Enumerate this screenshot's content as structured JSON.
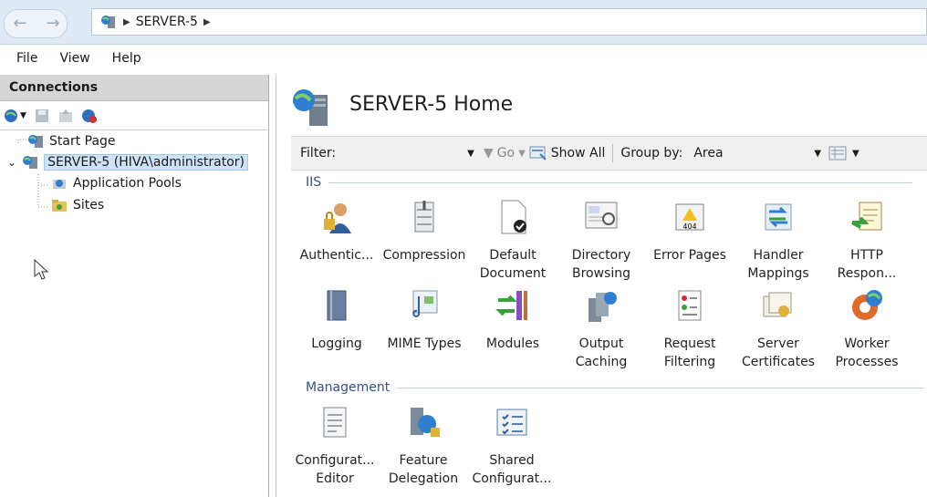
{
  "breadcrumb": {
    "server": "SERVER-5"
  },
  "menu": [
    "File",
    "View",
    "Help"
  ],
  "connections": {
    "header": "Connections",
    "tree": {
      "start_page": "Start Page",
      "server": "SERVER-5 (HIVA\\administrator)",
      "app_pools": "Application Pools",
      "sites": "Sites"
    }
  },
  "main": {
    "title": "SERVER-5 Home",
    "filter": {
      "label": "Filter:",
      "go": "Go",
      "show_all": "Show All",
      "group_by_label": "Group by:",
      "group_by_value": "Area"
    },
    "groups": {
      "iis": "IIS",
      "management": "Management"
    },
    "iis_features": [
      {
        "line1": "Authentic...",
        "line2": ""
      },
      {
        "line1": "Compression",
        "line2": ""
      },
      {
        "line1": "Default",
        "line2": "Document"
      },
      {
        "line1": "Directory",
        "line2": "Browsing"
      },
      {
        "line1": "Error Pages",
        "line2": ""
      },
      {
        "line1": "Handler",
        "line2": "Mappings"
      },
      {
        "line1": "HTTP",
        "line2": "Respon..."
      },
      {
        "line1": "Logging",
        "line2": ""
      },
      {
        "line1": "MIME Types",
        "line2": ""
      },
      {
        "line1": "Modules",
        "line2": ""
      },
      {
        "line1": "Output",
        "line2": "Caching"
      },
      {
        "line1": "Request",
        "line2": "Filtering"
      },
      {
        "line1": "Server",
        "line2": "Certificates"
      },
      {
        "line1": "Worker",
        "line2": "Processes"
      }
    ],
    "mgmt_features": [
      {
        "line1": "Configurat...",
        "line2": "Editor"
      },
      {
        "line1": "Feature",
        "line2": "Delegation"
      },
      {
        "line1": "Shared",
        "line2": "Configurat..."
      }
    ]
  },
  "colors": {
    "addr_bg": "#dfe9f5",
    "selection": "#cfe3f8",
    "group_text": "#36508a"
  }
}
